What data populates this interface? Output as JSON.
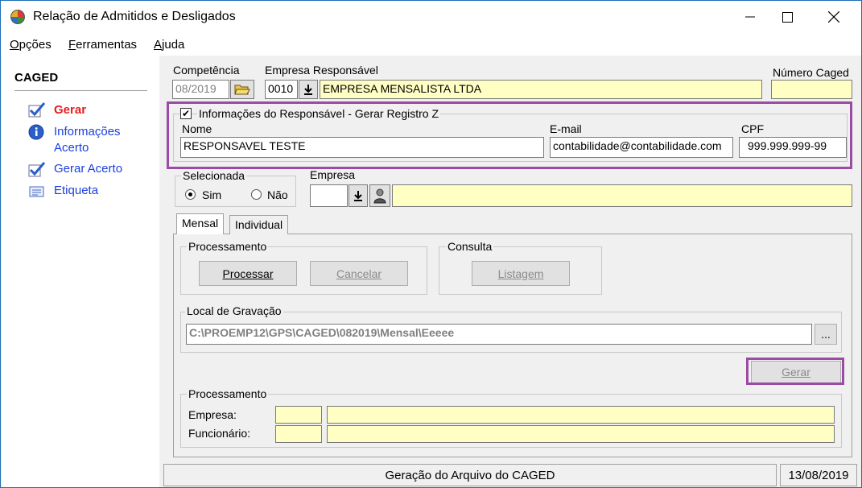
{
  "window": {
    "title": "Relação de Admitidos e Desligados",
    "minimize": "—",
    "maximize": "☐",
    "close": "✕"
  },
  "menu": {
    "opcoes_first": "O",
    "opcoes_rest": "pções",
    "ferramentas_first": "F",
    "ferramentas_rest": "erramentas",
    "ajuda_first": "A",
    "ajuda_rest": "juda"
  },
  "sidebar": {
    "title": "CAGED",
    "items": [
      {
        "label": "Gerar",
        "color": "#e81c1c"
      },
      {
        "label": "Informações",
        "label2": "Acerto",
        "color": "#1a3ee0"
      },
      {
        "label": "Gerar Acerto",
        "color": "#1a3ee0"
      },
      {
        "label": "Etiqueta",
        "color": "#1a3ee0"
      }
    ]
  },
  "header": {
    "competencia_label": "Competência",
    "competencia_value": "08/2019",
    "empresa_resp_label": "Empresa Responsável",
    "empresa_resp_code": "0010",
    "empresa_resp_name": "EMPRESA MENSALISTA LTDA",
    "numero_caged_label": "Número Caged",
    "numero_caged_value": ""
  },
  "responsavel": {
    "checkbox_label": "Informações do Responsável - Gerar Registro Z",
    "checked": "✔",
    "nome_label": "Nome",
    "nome_value": "RESPONSAVEL TESTE",
    "email_label": "E-mail",
    "email_value": "contabilidade@contabilidade.com",
    "cpf_label": "CPF",
    "cpf_value": "999.999.999-99"
  },
  "selecionada": {
    "label": "Selecionada",
    "sim": "Sim",
    "nao": "Não",
    "empresa_label": "Empresa",
    "empresa_code": "",
    "empresa_name": ""
  },
  "tabs": [
    "Mensal",
    "Individual"
  ],
  "processamento": {
    "title": "Processamento",
    "processar": "Processar",
    "cancelar": "Cancelar"
  },
  "consulta": {
    "title": "Consulta",
    "listagem": "Listagem"
  },
  "gravacao": {
    "title": "Local de Gravação",
    "path": "C:\\PROEMP12\\GPS\\CAGED\\082019\\Mensal\\Eeeee",
    "browse": "..."
  },
  "gerar_button": "Gerar",
  "processamento2": {
    "title": "Processamento",
    "empresa_label": "Empresa:",
    "funcionario_label": "Funcionário:"
  },
  "status": {
    "message": "Geração do Arquivo do CAGED",
    "date": "13/08/2019"
  },
  "colors": {
    "highlight": "#9b4aa6",
    "input_yellow": "#ffffc4",
    "link_blue": "#1a3ee0",
    "active_red": "#e81c1c"
  }
}
